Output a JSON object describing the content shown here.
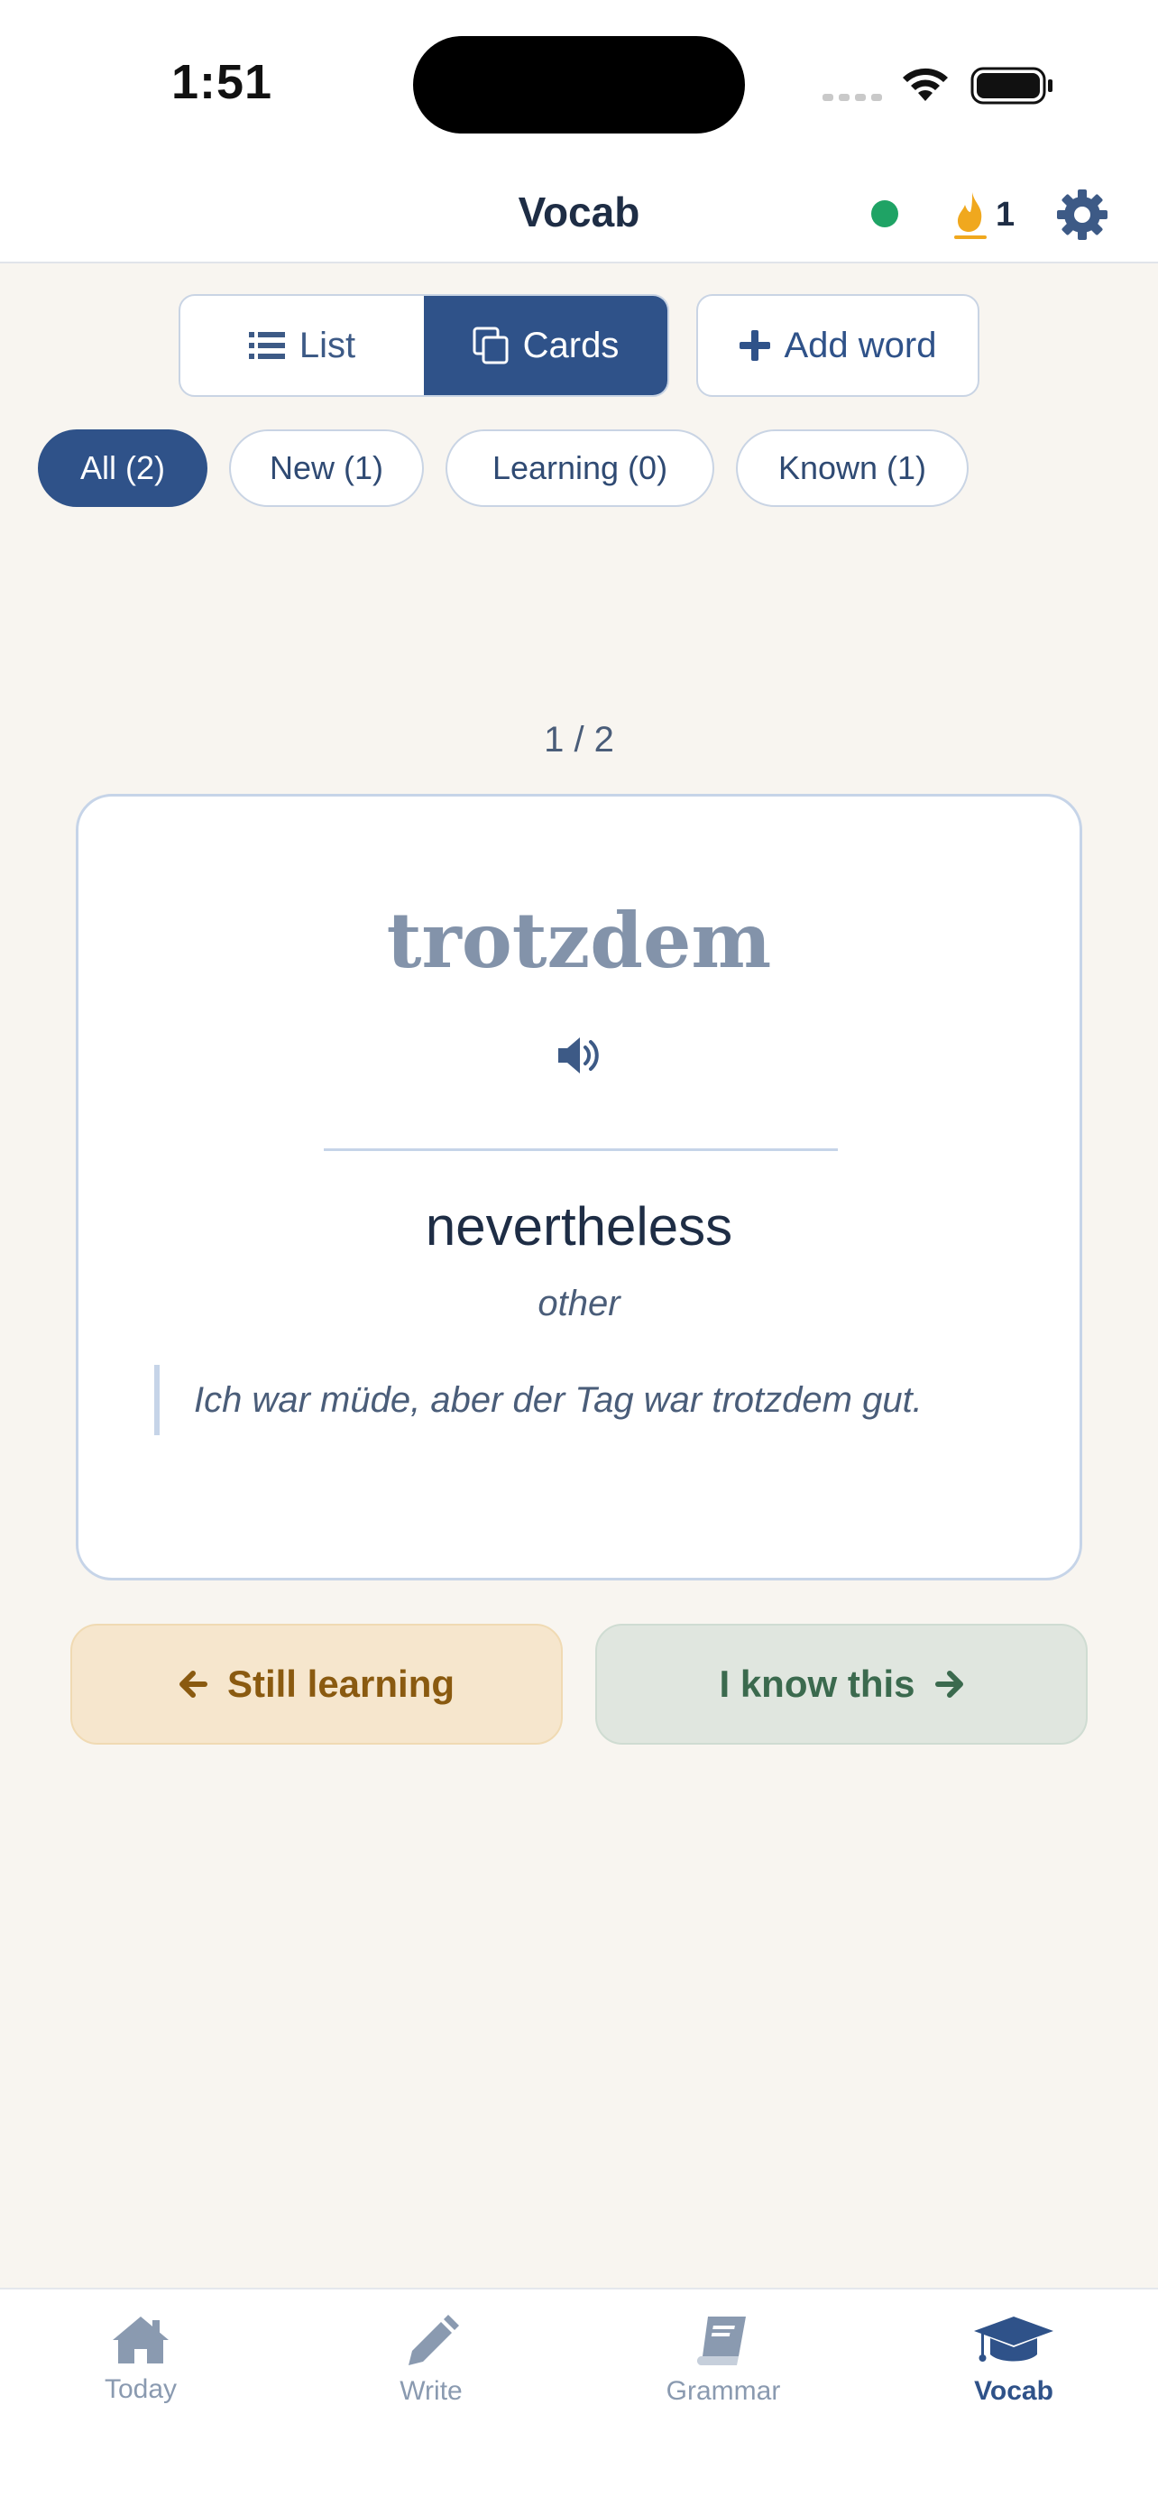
{
  "status_bar": {
    "time": "1:51"
  },
  "header": {
    "title": "Vocab",
    "streak_count": "1",
    "sync_color": "#1fa365"
  },
  "view_toggle": {
    "list_label": "List",
    "cards_label": "Cards",
    "selected": "Cards"
  },
  "add_word_label": "Add word",
  "filters": [
    {
      "label": "All (2)",
      "active": true
    },
    {
      "label": "New (1)",
      "active": false
    },
    {
      "label": "Learning (0)",
      "active": false
    },
    {
      "label": "Known (1)",
      "active": false
    }
  ],
  "card": {
    "counter": "1 / 2",
    "word": "trotzdem",
    "translation": "nevertheless",
    "type": "other",
    "example": "Ich war müde, aber der Tag war trotzdem gut."
  },
  "actions": {
    "still_learning": "Still learning",
    "know_this": "I know this"
  },
  "tabs": [
    {
      "label": "Today",
      "icon": "home-icon"
    },
    {
      "label": "Write",
      "icon": "pencil-icon"
    },
    {
      "label": "Grammar",
      "icon": "book-icon"
    },
    {
      "label": "Vocab",
      "icon": "graduation-cap-icon",
      "active": true
    }
  ],
  "colors": {
    "accent": "#2f5289",
    "background": "#f8f5f0",
    "learning": "#8a5a10",
    "known": "#3b6a4e",
    "streak": "#f0a81e"
  }
}
